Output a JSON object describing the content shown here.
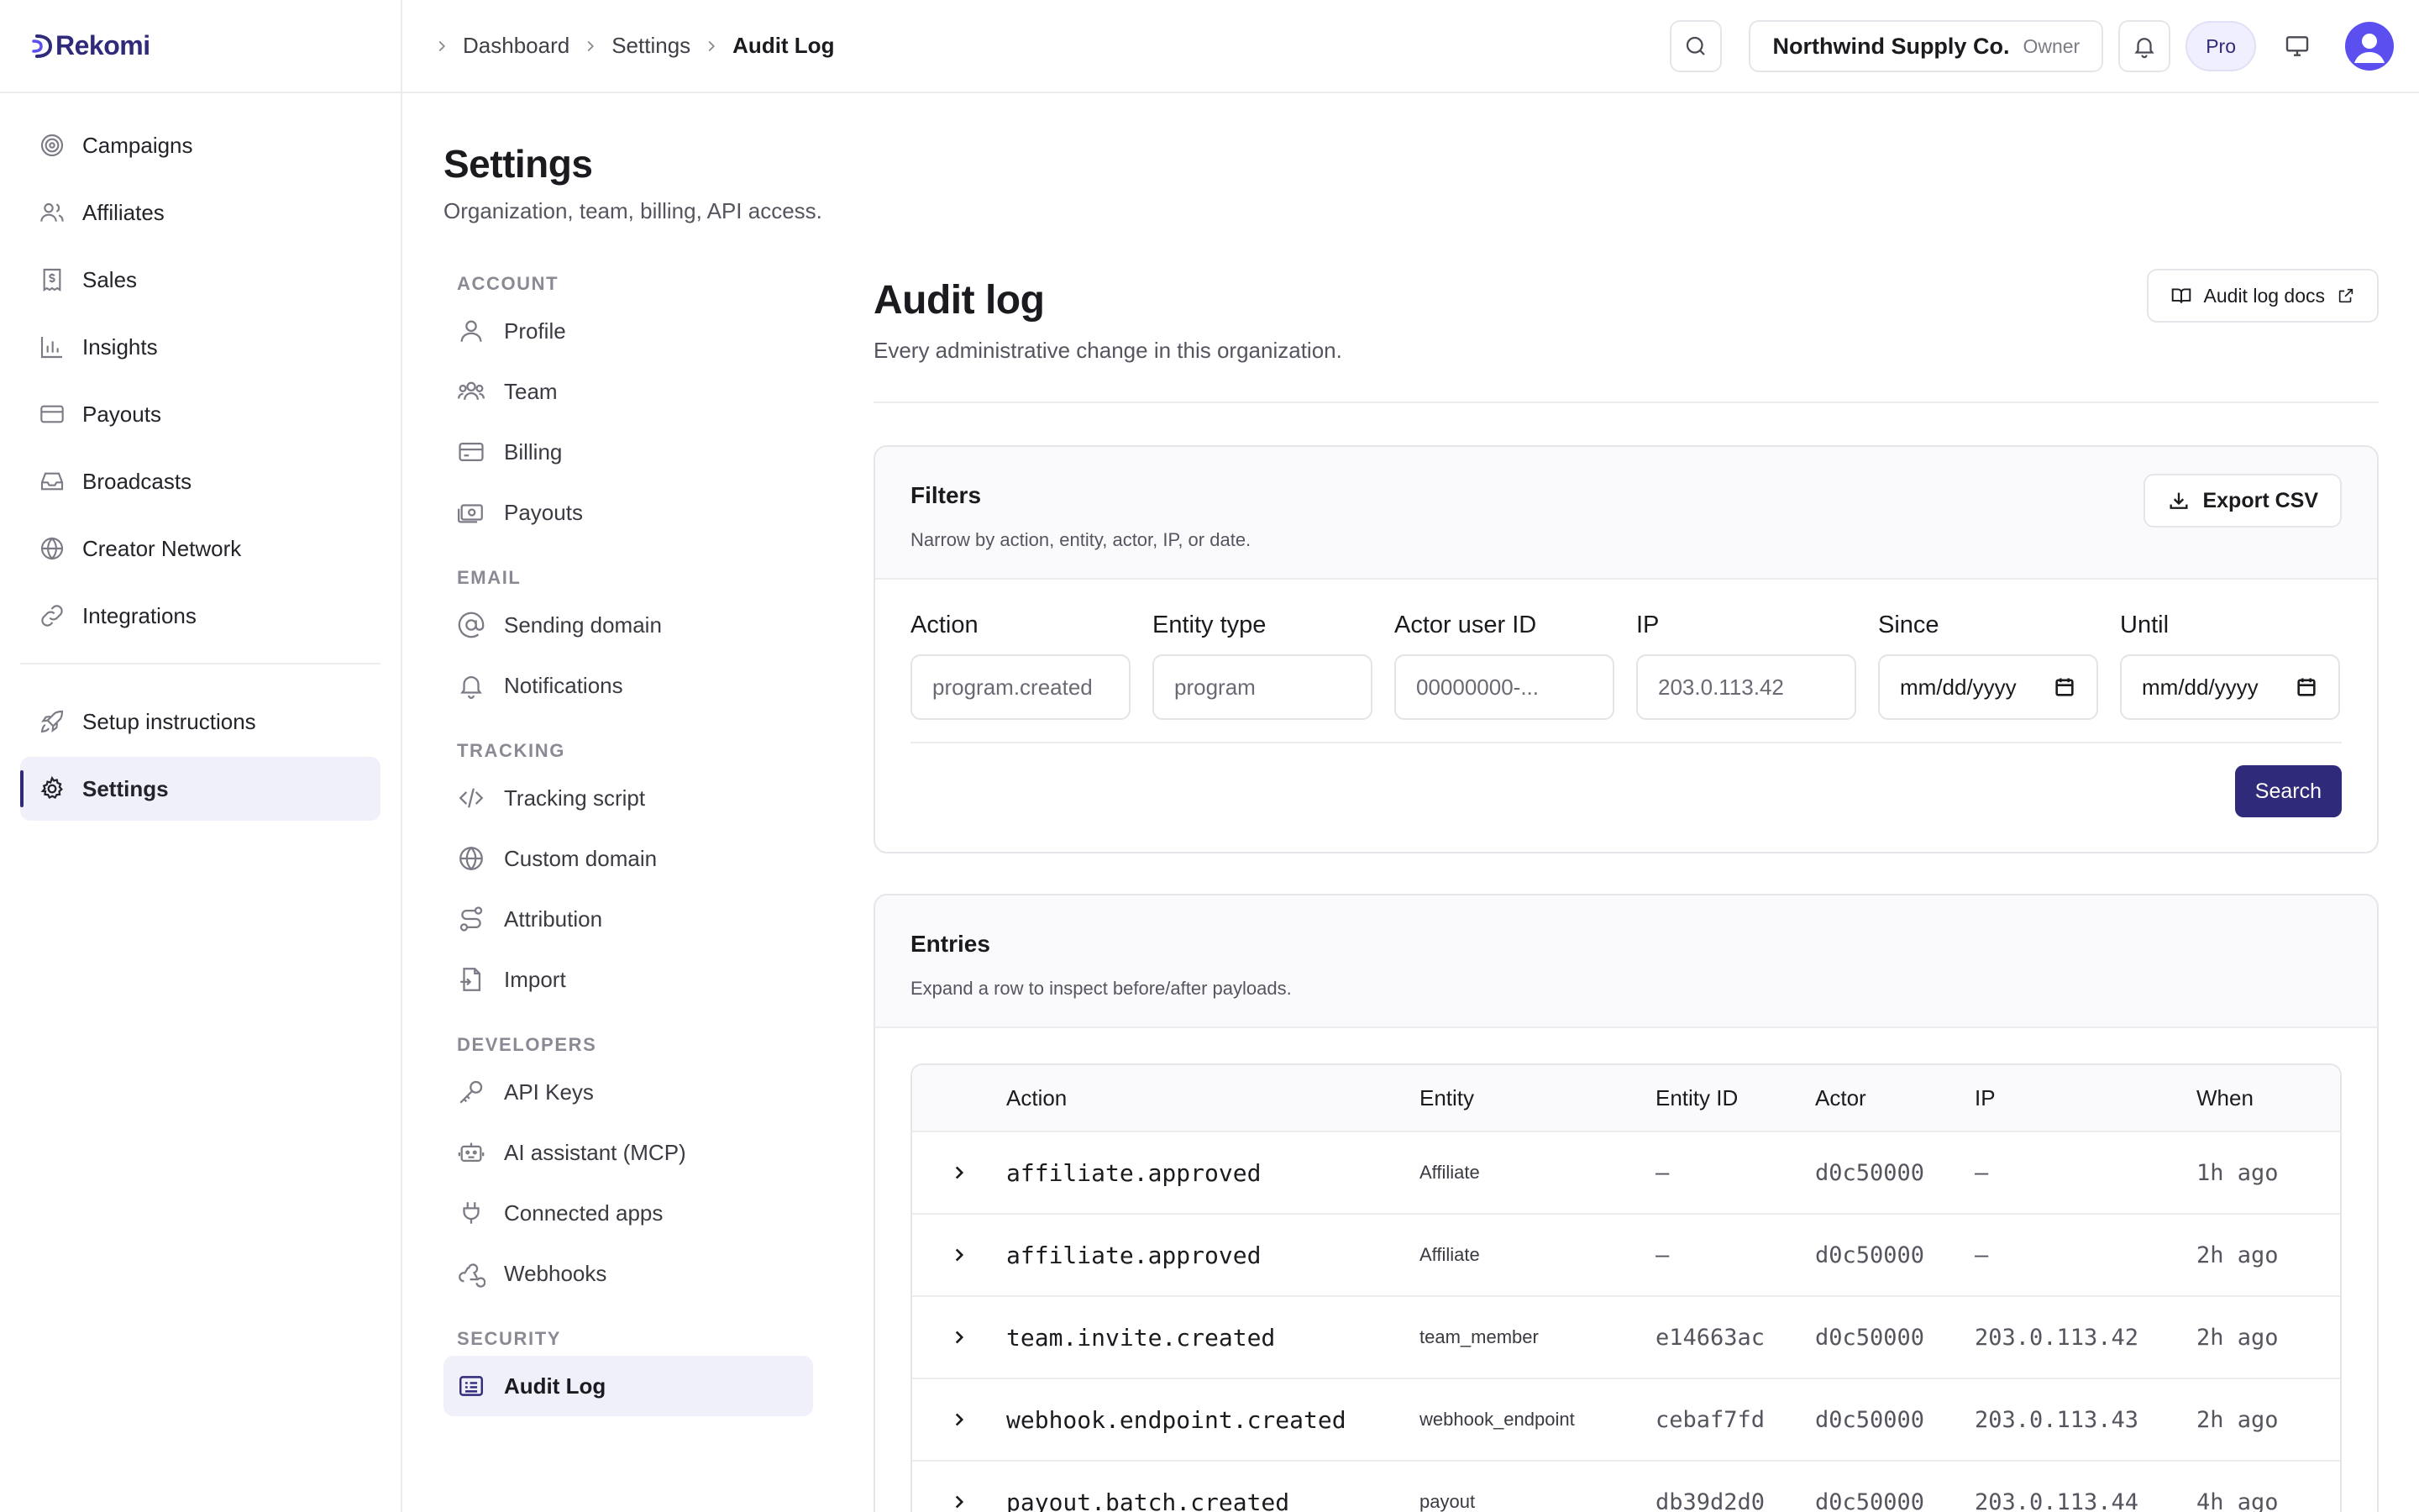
{
  "brand": {
    "name": "Rekomi"
  },
  "sidebar": {
    "items": [
      {
        "label": "Campaigns",
        "icon": "target-icon"
      },
      {
        "label": "Affiliates",
        "icon": "users-icon"
      },
      {
        "label": "Sales",
        "icon": "receipt-icon"
      },
      {
        "label": "Insights",
        "icon": "bar-chart-icon"
      },
      {
        "label": "Payouts",
        "icon": "credit-card-icon"
      },
      {
        "label": "Broadcasts",
        "icon": "inbox-icon"
      },
      {
        "label": "Creator Network",
        "icon": "globe-icon"
      },
      {
        "label": "Integrations",
        "icon": "link-icon"
      }
    ],
    "secondary": [
      {
        "label": "Setup instructions",
        "icon": "rocket-icon"
      },
      {
        "label": "Settings",
        "icon": "gear-icon",
        "active": true
      }
    ]
  },
  "breadcrumb": {
    "items": [
      "Dashboard",
      "Settings",
      "Audit Log"
    ]
  },
  "topbar": {
    "org_name": "Northwind Supply Co.",
    "org_role": "Owner",
    "plan_badge": "Pro"
  },
  "settings": {
    "title": "Settings",
    "subtitle": "Organization, team, billing, API access.",
    "sections": [
      {
        "heading": "ACCOUNT",
        "items": [
          "Profile",
          "Team",
          "Billing",
          "Payouts"
        ]
      },
      {
        "heading": "EMAIL",
        "items": [
          "Sending domain",
          "Notifications"
        ]
      },
      {
        "heading": "TRACKING",
        "items": [
          "Tracking script",
          "Custom domain",
          "Attribution",
          "Import"
        ]
      },
      {
        "heading": "DEVELOPERS",
        "items": [
          "API Keys",
          "AI assistant (MCP)",
          "Connected apps",
          "Webhooks"
        ]
      },
      {
        "heading": "SECURITY",
        "items": [
          "Audit Log"
        ]
      }
    ]
  },
  "audit": {
    "title": "Audit log",
    "subtitle": "Every administrative change in this organization.",
    "docs_label": "Audit log docs"
  },
  "filters": {
    "title": "Filters",
    "description": "Narrow by action, entity, actor, IP, or date.",
    "export_label": "Export CSV",
    "fields": [
      {
        "label": "Action",
        "placeholder": "program.created"
      },
      {
        "label": "Entity type",
        "placeholder": "program"
      },
      {
        "label": "Actor user ID",
        "placeholder": "00000000-..."
      },
      {
        "label": "IP",
        "placeholder": "203.0.113.42"
      },
      {
        "label": "Since",
        "placeholder": "mm/dd/yyyy"
      },
      {
        "label": "Until",
        "placeholder": "mm/dd/yyyy"
      }
    ],
    "search_label": "Search"
  },
  "entries": {
    "title": "Entries",
    "description": "Expand a row to inspect before/after payloads.",
    "columns": [
      "Action",
      "Entity",
      "Entity ID",
      "Actor",
      "IP",
      "When"
    ],
    "rows": [
      {
        "action": "affiliate.approved",
        "entity": "Affiliate",
        "entity_id": "—",
        "actor": "d0c50000",
        "ip": "—",
        "when": "1h ago"
      },
      {
        "action": "affiliate.approved",
        "entity": "Affiliate",
        "entity_id": "—",
        "actor": "d0c50000",
        "ip": "—",
        "when": "2h ago"
      },
      {
        "action": "team.invite.created",
        "entity": "team_member",
        "entity_id": "e14663ac",
        "actor": "d0c50000",
        "ip": "203.0.113.42",
        "when": "2h ago"
      },
      {
        "action": "webhook.endpoint.created",
        "entity": "webhook_endpoint",
        "entity_id": "cebaf7fd",
        "actor": "d0c50000",
        "ip": "203.0.113.43",
        "when": "2h ago"
      },
      {
        "action": "payout.batch.created",
        "entity": "payout",
        "entity_id": "db39d2d0",
        "actor": "d0c50000",
        "ip": "203.0.113.44",
        "when": "4h ago"
      }
    ]
  },
  "colors": {
    "brand": "#2f2a7a",
    "active_bg": "#f0f0fb",
    "avatar": "#5b4ff0"
  }
}
